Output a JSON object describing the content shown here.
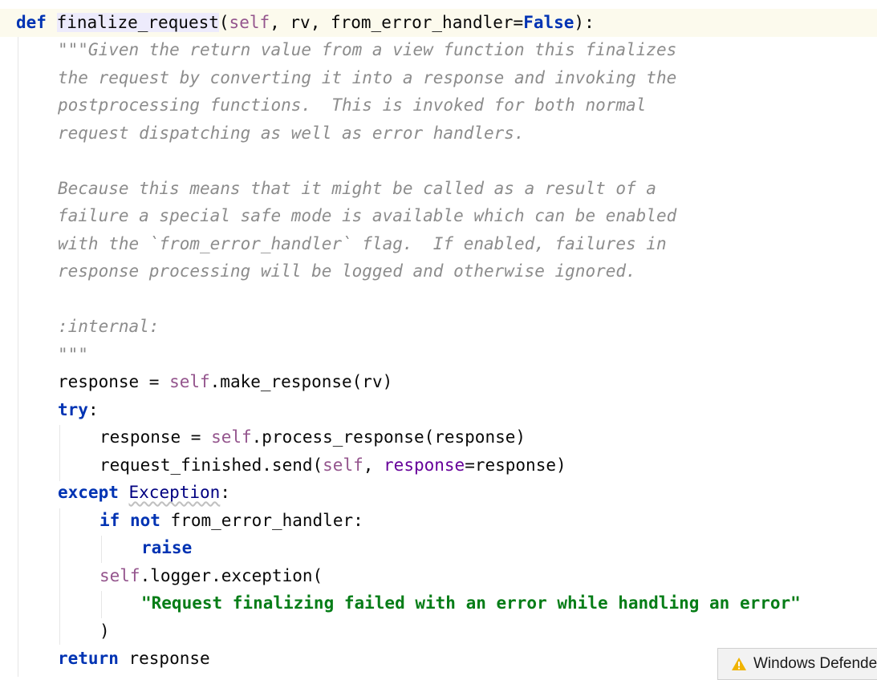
{
  "code": {
    "def_kw": "def",
    "fn_name": "finalize_request",
    "params_open": "(",
    "self_param": "self",
    "params_mid": ", rv, from_error_handler=",
    "false_kw": "False",
    "params_close": "):",
    "doc": [
      "\"\"\"Given the return value from a view function this finalizes",
      "the request by converting it into a response and invoking the",
      "postprocessing functions.  This is invoked for both normal",
      "request dispatching as well as error handlers.",
      "",
      "Because this means that it might be called as a result of a",
      "failure a special safe mode is available which can be enabled",
      "with the `from_error_handler` flag.  If enabled, failures in",
      "response processing will be logged and otherwise ignored.",
      "",
      ":internal:",
      "\"\"\""
    ],
    "l15_a": "response = ",
    "l15_self": "self",
    "l15_b": ".make_response(rv)",
    "try_kw": "try",
    "colon": ":",
    "l17_a": "response = ",
    "l17_self": "self",
    "l17_b": ".process_response(response)",
    "l18_a": "request_finished.send(",
    "l18_self": "self",
    "l18_b": ", ",
    "l18_named": "response",
    "l18_c": "=response)",
    "except_kw": "except",
    "exception_cls": "Exception",
    "if_kw": "if",
    "not_kw": "not",
    "l20_rest": " from_error_handler:",
    "raise_kw": "raise",
    "l22_self": "self",
    "l22_rest": ".logger.exception(",
    "error_str": "\"Request finalizing failed with an error while handling an error\"",
    "close_paren": ")",
    "return_kw": "return",
    "return_rest": " response"
  },
  "notification": {
    "icon": "warning-icon",
    "text": "Windows Defender"
  }
}
